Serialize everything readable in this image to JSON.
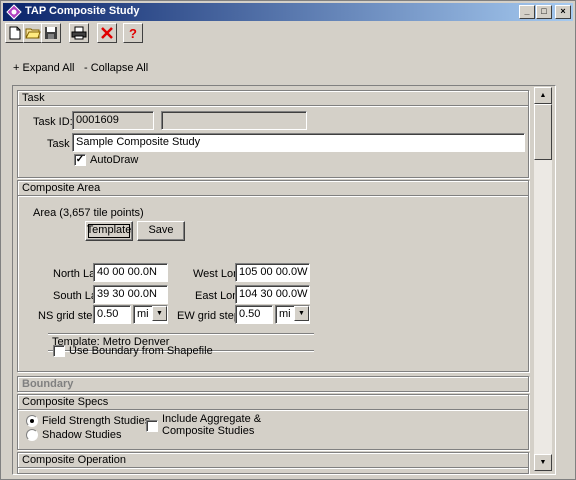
{
  "window": {
    "title": "TAP Composite Study"
  },
  "window_controls": {
    "minimize": "_",
    "maximize": "□",
    "close": "×"
  },
  "toolbar": {
    "buttons": [
      {
        "name": "new-document-icon",
        "glyph": "🗋"
      },
      {
        "name": "open-folder-icon",
        "glyph": "📂"
      },
      {
        "name": "save-disk-icon",
        "glyph": "💾"
      },
      {
        "name": "print-icon",
        "glyph": "🖶"
      },
      {
        "name": "delete-x-icon",
        "glyph": "✕"
      },
      {
        "name": "help-icon",
        "glyph": "?"
      }
    ]
  },
  "actions": {
    "expand_all": "+ Expand All",
    "collapse_all": "- Collapse All"
  },
  "task": {
    "header": "Task",
    "id_label": "Task ID:",
    "id_value": "0001609",
    "id_extra": "",
    "task_label": "Task",
    "task_value": "Sample Composite Study",
    "autodraw_label": "AutoDraw",
    "autodraw_checked": true
  },
  "composite_area": {
    "header": "Composite Area",
    "area_text": "Area (3,657 tile points)",
    "template_button": "Template",
    "save_button": "Save",
    "template_name": "Template: Metro Denver",
    "north_lat_label": "North Lat",
    "north_lat": "40 00 00.0N",
    "south_lat_label": "South Lat",
    "south_lat": "39 30 00.0N",
    "west_lon_label": "West Lon",
    "west_lon": "105 00 00.0W",
    "east_lon_label": "East Lon",
    "east_lon": "104 30 00.0W",
    "ns_grid_label": "NS grid step:",
    "ns_grid_value": "0.50",
    "ns_grid_unit": "mi",
    "ew_grid_label": "EW grid step:",
    "ew_grid_value": "0.50",
    "ew_grid_unit": "mi",
    "use_boundary_label": "Use Boundary from Shapefile",
    "use_boundary_checked": false
  },
  "boundary": {
    "header": "Boundary"
  },
  "composite_specs": {
    "header": "Composite Specs",
    "option_field": "Field Strength Studies",
    "option_shadow": "Shadow Studies",
    "selected": "field",
    "include_label_line1": "Include Aggregate &",
    "include_label_line2": "Composite Studies",
    "include_checked": false
  },
  "composite_operation": {
    "header": "Composite Operation"
  }
}
